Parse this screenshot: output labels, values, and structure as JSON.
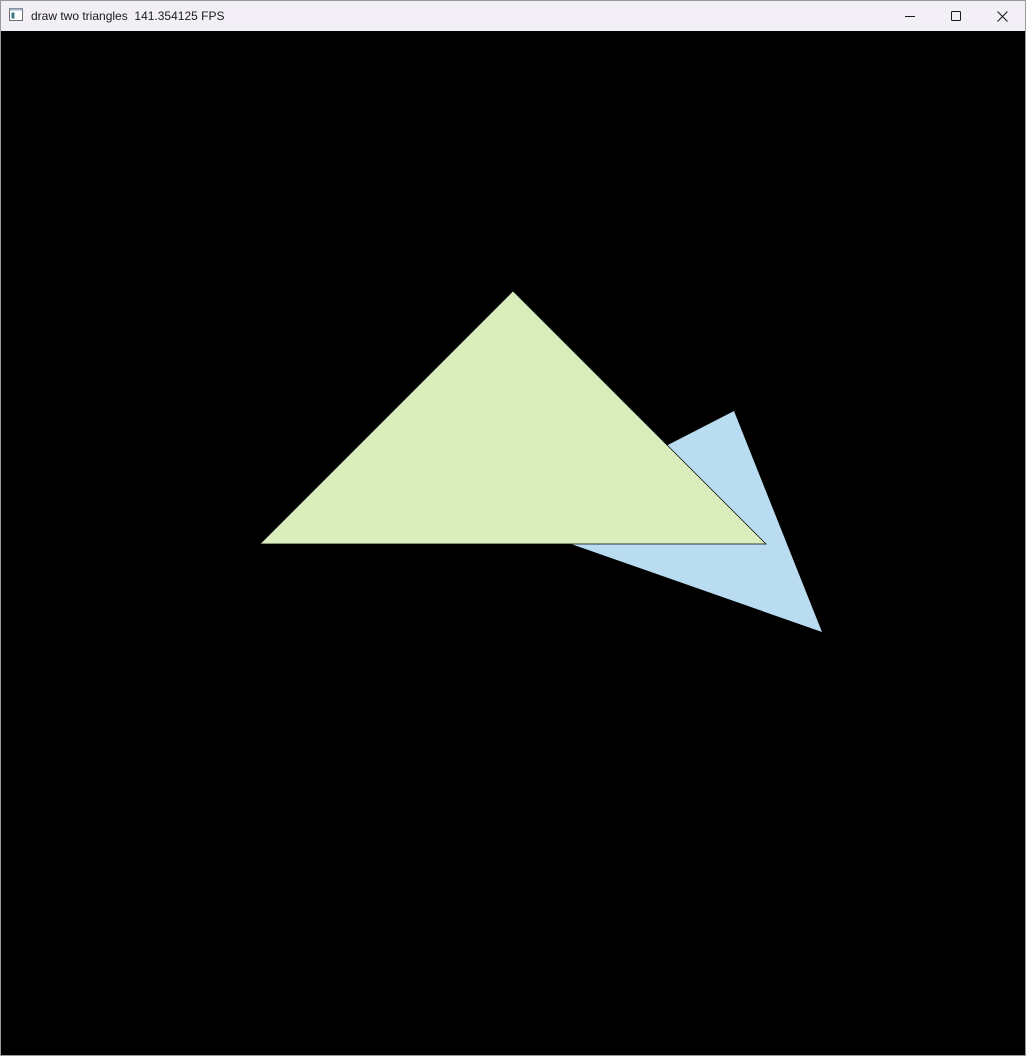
{
  "window": {
    "title": "draw two triangles",
    "fps_text": "141.354125 FPS",
    "app_icon": "window-app-icon",
    "controls": {
      "minimize_icon": "minimize-icon",
      "maximize_icon": "maximize-icon",
      "close_icon": "close-icon"
    }
  },
  "scene": {
    "background_color": "#000000",
    "triangles": [
      {
        "name": "blue-triangle",
        "color": "#b9dcf0",
        "layer": "back"
      },
      {
        "name": "green-triangle",
        "color": "#daedbc",
        "layer": "front",
        "outline": "#000000"
      }
    ]
  }
}
